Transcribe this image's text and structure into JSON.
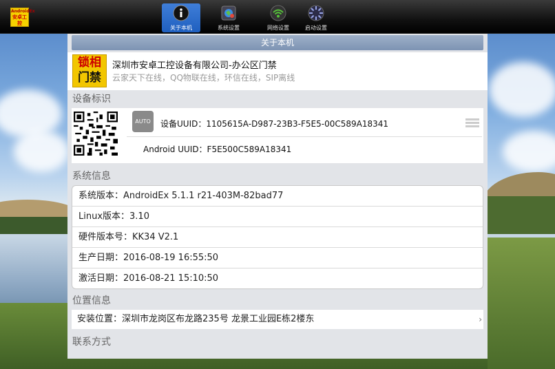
{
  "toolbar": {
    "logo_text_1": "AndroidEx",
    "logo_text_2": "安卓工控",
    "items": [
      {
        "label": "关于本机",
        "icon": "info-icon",
        "active": true
      },
      {
        "label": "系统设置",
        "icon": "system-settings-icon",
        "active": false
      },
      {
        "label": "网络设置",
        "icon": "wifi-icon",
        "active": false
      },
      {
        "label": "启动设置",
        "icon": "startup-icon",
        "active": false
      }
    ]
  },
  "page": {
    "title": "关于本机"
  },
  "brand": {
    "logo_top": "锁相",
    "logo_bottom": "门禁",
    "title": "深圳市安卓工控设备有限公司-办公区门禁",
    "subtitle": "云家天下在线，QQ物联在线，环信在线，SIP离线"
  },
  "device_id": {
    "section_title": "设备标识",
    "auto_label": "AUTO",
    "uuid_line": "设备UUID：1105615A-D987-23B3-F5E5-00C589A18341",
    "android_uuid_line": "Android UUID：F5E500C589A18341"
  },
  "system_info": {
    "section_title": "系统信息",
    "rows": [
      "系统版本：AndroidEx 5.1.1 r21-403M-82bad77",
      "Linux版本：3.10",
      "硬件版本号：KK34 V2.1",
      "生产日期：2016-08-19 16:55:50",
      "激活日期：2016-08-21 15:10:50"
    ]
  },
  "location": {
    "section_title": "位置信息",
    "install_location": "安装位置：深圳市龙岗区布龙路235号 龙景工业园E栋2楼东"
  },
  "contact": {
    "section_title": "联系方式"
  },
  "colors": {
    "active_tab": "#2a6bcc",
    "header_bar": "#8da1bf",
    "logo_yellow": "#f2c600"
  }
}
